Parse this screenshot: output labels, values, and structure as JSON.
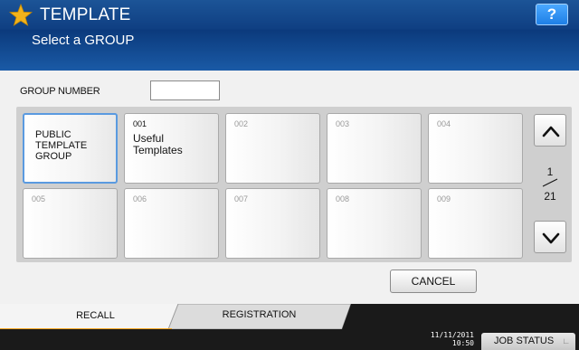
{
  "header": {
    "title": "TEMPLATE",
    "subtitle": "Select a GROUP",
    "help_label": "?"
  },
  "group_number": {
    "label": "GROUP NUMBER",
    "value": ""
  },
  "groups": [
    {
      "number": "",
      "name": "PUBLIC TEMPLATE GROUP"
    },
    {
      "number": "001",
      "name": "Useful Templates"
    },
    {
      "number": "002",
      "name": ""
    },
    {
      "number": "003",
      "name": ""
    },
    {
      "number": "004",
      "name": ""
    },
    {
      "number": "005",
      "name": ""
    },
    {
      "number": "006",
      "name": ""
    },
    {
      "number": "007",
      "name": ""
    },
    {
      "number": "008",
      "name": ""
    },
    {
      "number": "009",
      "name": ""
    }
  ],
  "pager": {
    "current": "1",
    "total": "21"
  },
  "cancel_label": "CANCEL",
  "tabs": {
    "recall": "RECALL",
    "registration": "REGISTRATION"
  },
  "footer": {
    "date": "11/11/2011",
    "time": "10:50",
    "job_status_label": "JOB STATUS"
  },
  "colors": {
    "header_blue": "#0f3f82",
    "accent_orange": "#f0a11a",
    "help_blue": "#1e7fe6",
    "selected_border": "#5a9ae0"
  },
  "icons": {
    "title": "star-icon",
    "scroll_up": "chevron-up-icon",
    "scroll_down": "chevron-down-icon"
  }
}
